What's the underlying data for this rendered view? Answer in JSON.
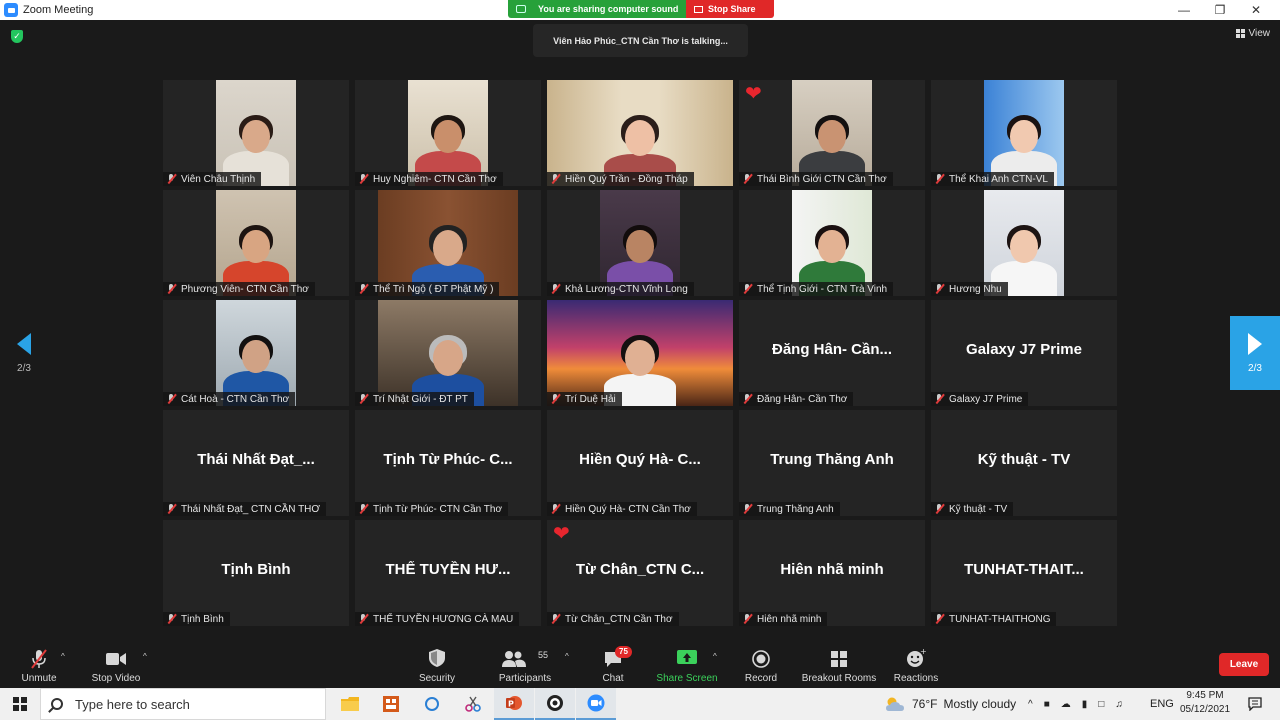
{
  "window": {
    "title": "Zoom Meeting",
    "minimize": "—",
    "maximize": "❐",
    "close": "✕"
  },
  "share_banner": {
    "sound_text": "You are sharing computer sound",
    "stop_share_label": "Stop Share"
  },
  "talking": "Viên Hảo Phúc_CTN Cần Thơ is talking...",
  "view_label": "View",
  "pagination": {
    "left": "2/3",
    "right": "2/3"
  },
  "participants": [
    {
      "name": "Viên Châu Thịnh",
      "video": "w80",
      "scene": "wall"
    },
    {
      "name": "Huy Nghiêm- CTN Cần Thơ",
      "video": "w80",
      "scene": "heart"
    },
    {
      "name": "Hiền Quý Trần - Đồng Tháp",
      "video": "full",
      "scene": "girl"
    },
    {
      "name": "Thái Bình Giới CTN Cần Thơ",
      "video": "w80",
      "scene": "man",
      "heart": true
    },
    {
      "name": "Thể Khai Anh CTN-VL",
      "video": "w80",
      "scene": "blue"
    },
    {
      "name": "Phương Viên- CTN Cần Thơ",
      "video": "w80",
      "scene": "woman"
    },
    {
      "name": "Thể Trì Ngộ ( ĐT Phật Mỹ )",
      "video": "w140",
      "scene": "door"
    },
    {
      "name": "Khả Lương-CTN Vĩnh Long",
      "video": "w80",
      "scene": "woman2"
    },
    {
      "name": "Thể Tịnh Giới - CTN Trà Vinh",
      "video": "w80",
      "scene": "office"
    },
    {
      "name": "Hương Nhu",
      "video": "w80",
      "scene": "girl2"
    },
    {
      "name": "Cát Hoà - CTN Cần Thơ",
      "video": "w80",
      "scene": "mask"
    },
    {
      "name": "Trí Nhật Giới - ĐT PT",
      "video": "w140",
      "scene": "old"
    },
    {
      "name": "Trí Duệ Hải",
      "video": "full",
      "scene": "sunset"
    },
    {
      "name": "Đăng Hân- Cần Thơ",
      "big": "Đăng Hân- Cần..."
    },
    {
      "name": "Galaxy J7 Prime",
      "big": "Galaxy J7 Prime"
    },
    {
      "name": "Thái Nhất Đạt_ CTN CẦN THƠ",
      "big": "Thái Nhất Đạt_..."
    },
    {
      "name": "Tịnh Từ Phúc- CTN Cần Thơ",
      "big": "Tịnh Từ Phúc- C..."
    },
    {
      "name": "Hiền Quý Hà- CTN Cần Thơ",
      "big": "Hiền Quý Hà- C..."
    },
    {
      "name": "Trung Thăng Anh",
      "big": "Trung Thăng Anh"
    },
    {
      "name": "Kỹ thuật - TV",
      "big": "Kỹ thuật - TV"
    },
    {
      "name": "Tịnh Bình",
      "big": "Tịnh Bình"
    },
    {
      "name": "THỂ TUYỀN HƯƠNG CÀ MAU",
      "big": "THỂ TUYỀN HƯ..."
    },
    {
      "name": "Từ Chân_CTN Cần Thơ",
      "big": "Từ Chân_CTN C...",
      "heart": true
    },
    {
      "name": "Hiên nhã minh",
      "big": "Hiên nhã minh"
    },
    {
      "name": "TUNHAT-THAITHONG",
      "big": "TUNHAT-THAIT..."
    }
  ],
  "toolbar": {
    "unmute": "Unmute",
    "stop_video": "Stop Video",
    "security": "Security",
    "participants": "Participants",
    "participants_count": "55",
    "chat": "Chat",
    "chat_badge": "75",
    "share_screen": "Share Screen",
    "record": "Record",
    "breakout_rooms": "Breakout Rooms",
    "reactions": "Reactions",
    "leave": "Leave"
  },
  "taskbar": {
    "search_placeholder": "Type here to search",
    "weather_temp": "76°F",
    "weather_text": "Mostly cloudy",
    "language": "ENG",
    "time": "9:45 PM",
    "date": "05/12/2021"
  },
  "colors": {
    "accent_blue": "#2aa3e6",
    "share_green": "#27a13a",
    "stop_red": "#e02828",
    "leave_red": "#e02828"
  }
}
